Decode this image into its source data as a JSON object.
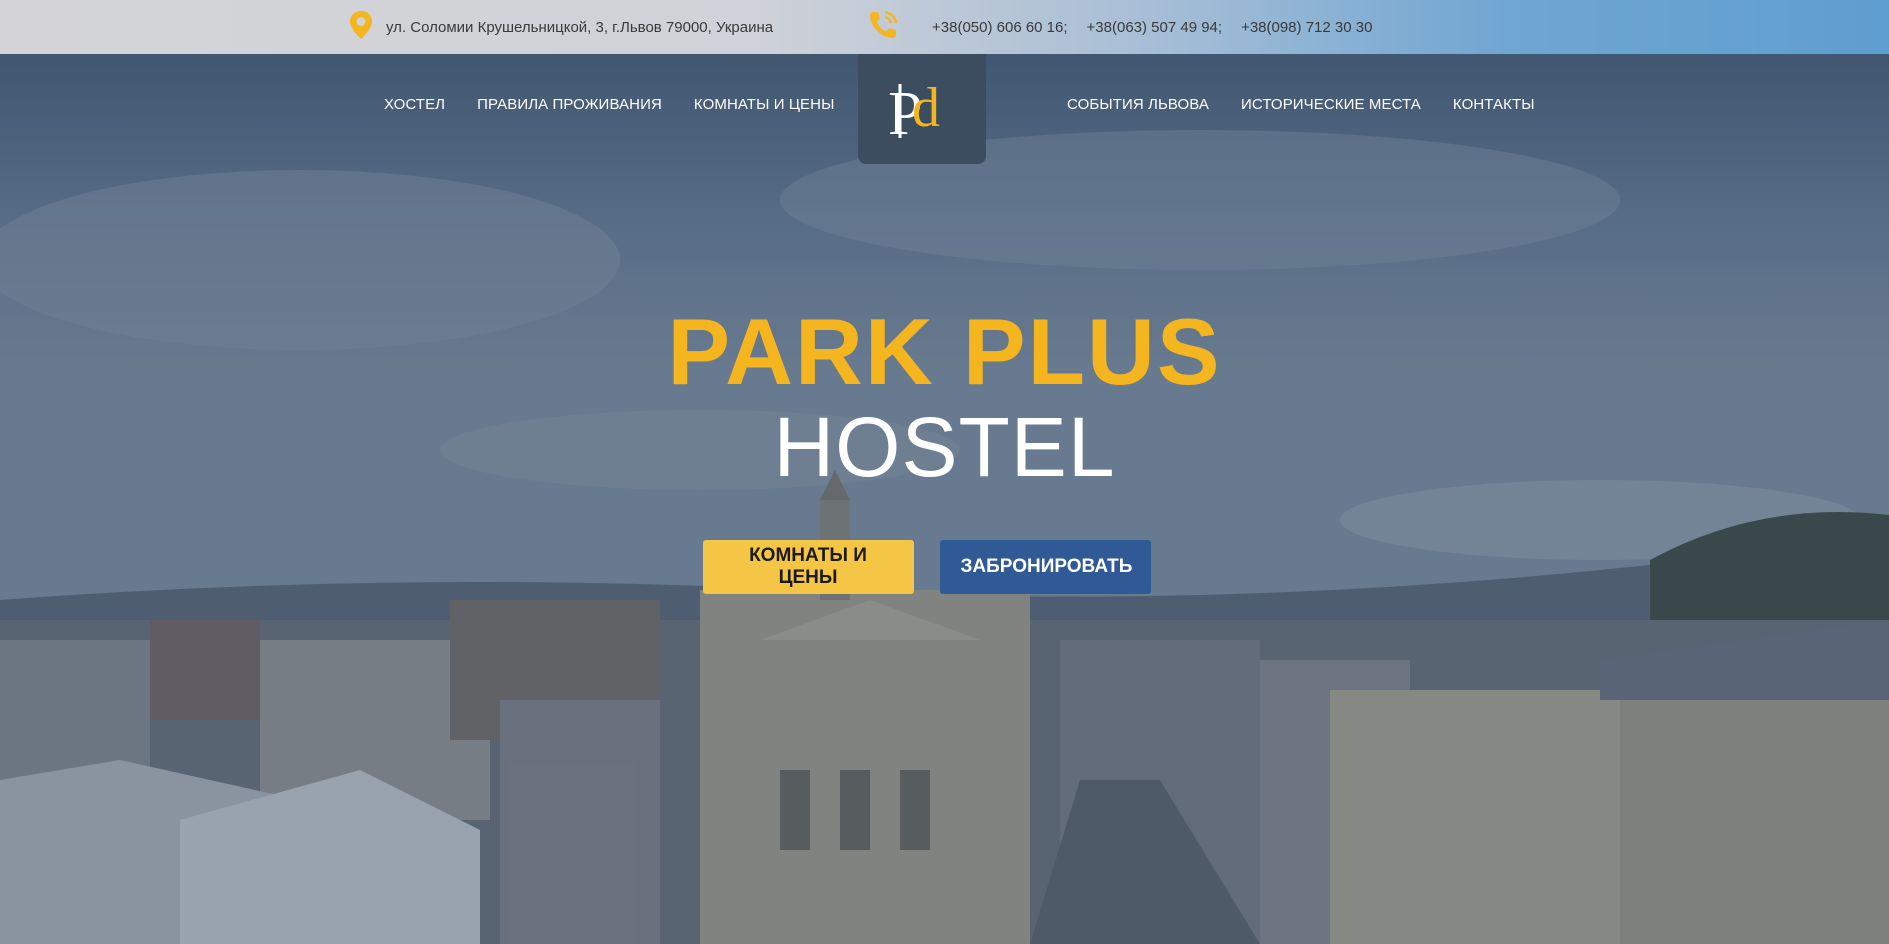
{
  "topbar": {
    "address": "ул. Соломии Крушельницкой, 3, г.Львов 79000, Украина",
    "phones": [
      "+38(050) 606 60 16;",
      "+38(063) 507 49 94;",
      "+38(098) 712 30 30"
    ],
    "location_icon": "map-pin-icon",
    "phone_icon": "phone-icon"
  },
  "nav": {
    "left": [
      "ХОСТЕЛ",
      "ПРАВИЛА ПРОЖИВАНИЯ",
      "КОМНАТЫ И ЦЕНЫ"
    ],
    "right": [
      "СОБЫТИЯ ЛЬВОВА",
      "ИСТОРИЧЕСКИЕ МЕСТА",
      "КОНТАКТЫ"
    ]
  },
  "logo": {
    "letters": "Pd"
  },
  "hero": {
    "title_line1": "PARK PLUS",
    "title_line2": "HOSTEL",
    "button_rooms": "КОМНАТЫ И ЦЕНЫ",
    "button_book": "ЗАБРОНИРОВАТЬ"
  },
  "colors": {
    "accent_yellow": "#f5b51f",
    "button_yellow": "#f5c545",
    "button_blue": "#2f5a96",
    "logo_bg": "#3d4d60"
  }
}
